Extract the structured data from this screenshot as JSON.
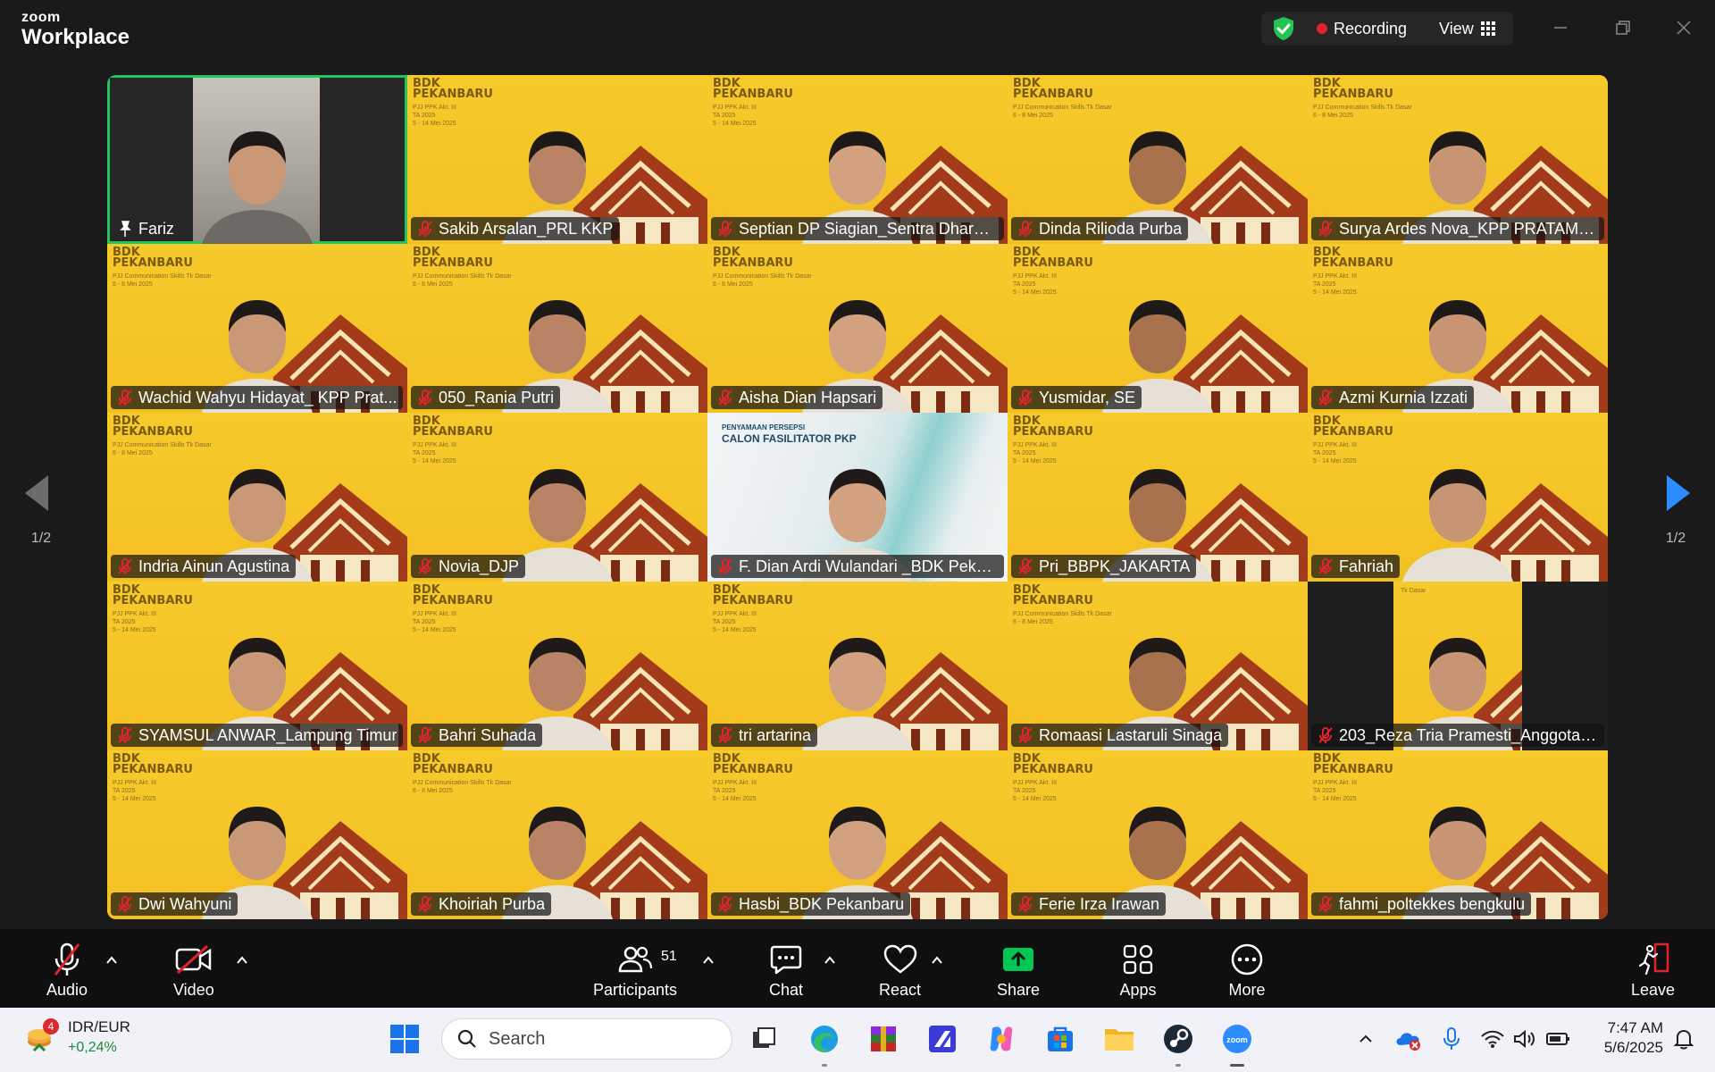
{
  "app": {
    "brand_small": "zoom",
    "brand_big": "Workplace"
  },
  "header": {
    "recording_label": "Recording",
    "view_label": "View"
  },
  "pager": {
    "left": "1/2",
    "right": "1/2"
  },
  "participants": [
    {
      "name": "Fariz",
      "variant": "active"
    },
    {
      "name": "Sakib Arsalan_PRL KKP",
      "variant": "ppk"
    },
    {
      "name": "Septian DP Siagian_Sentra Dharm...",
      "variant": "ppk"
    },
    {
      "name": "Dinda Rilioda Purba",
      "variant": "comm"
    },
    {
      "name": "Surya Ardes Nova_KPP PRATAMA ...",
      "variant": "comm"
    },
    {
      "name": "Wachid Wahyu Hidayat_ KPP Prat...",
      "variant": "comm"
    },
    {
      "name": "050_Rania Putri",
      "variant": "comm"
    },
    {
      "name": "Aisha Dian Hapsari",
      "variant": "comm"
    },
    {
      "name": "Yusmidar, SE",
      "variant": "ppk"
    },
    {
      "name": "Azmi Kurnia Izzati",
      "variant": "ppk"
    },
    {
      "name": "Indria Ainun Agustina",
      "variant": "comm"
    },
    {
      "name": "Novia_DJP",
      "variant": "ppk"
    },
    {
      "name": "F. Dian Ardi Wulandari _BDK Peka...",
      "variant": "white"
    },
    {
      "name": "Pri_BBPK_JAKARTA",
      "variant": "ppk"
    },
    {
      "name": "Fahriah",
      "variant": "ppk"
    },
    {
      "name": "SYAMSUL ANWAR_Lampung Timur",
      "variant": "ppk"
    },
    {
      "name": "Bahri Suhada",
      "variant": "ppk"
    },
    {
      "name": "tri artarina",
      "variant": "ppk"
    },
    {
      "name": "Romaasi Lastaruli Sinaga",
      "variant": "comm"
    },
    {
      "name": "203_Reza Tria Pramesti_Anggota B...",
      "variant": "dark"
    },
    {
      "name": "Dwi Wahyuni",
      "variant": "ppk"
    },
    {
      "name": "Khoiriah Purba",
      "variant": "comm"
    },
    {
      "name": "Hasbi_BDK Pekanbaru",
      "variant": "ppk"
    },
    {
      "name": "Ferie Irza Irawan",
      "variant": "ppk"
    },
    {
      "name": "fahmi_poltekkes bengkulu",
      "variant": "ppk"
    }
  ],
  "tile_texts": {
    "bdk1": "BDK",
    "bdk2": "PEKANBARU",
    "ppk_sub1": "PJJ PPK Akt. III",
    "ppk_sub2": "TA 2025",
    "ppk_sub3": "5 - 14 Mei 2025",
    "comm_sub1": "PJJ Communication Skills Tk Dasar",
    "comm_sub2": "6 - 8 Mei 2025",
    "white_t1": "PENYAMAAN PERSEPSI",
    "white_t2": "CALON FASILITATOR PKP",
    "dark_t": "Tk Dasar"
  },
  "toolbar": {
    "audio": "Audio",
    "video": "Video",
    "participants": "Participants",
    "participants_count": "51",
    "chat": "Chat",
    "react": "React",
    "share": "Share",
    "apps": "Apps",
    "more": "More",
    "leave": "Leave"
  },
  "taskbar": {
    "widget_title": "IDR/EUR",
    "widget_change": "+0,24%",
    "widget_badge": "4",
    "search_placeholder": "Search",
    "time": "7:47 AM",
    "date": "5/6/2025"
  }
}
